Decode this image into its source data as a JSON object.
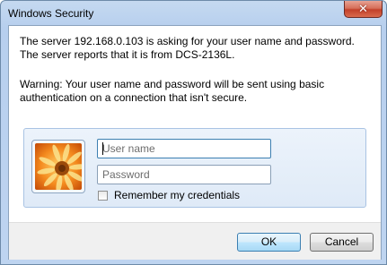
{
  "window": {
    "title": "Windows Security"
  },
  "titlebar": {
    "close_icon": "close-icon",
    "close_glyph": "✕"
  },
  "message": {
    "line1": "The server 192.168.0.103 is asking for your user name and password. The server reports that it is from DCS-2136L.",
    "line2": "Warning: Your user name and password will be sent using basic authentication on a connection that isn't secure."
  },
  "credentials": {
    "user_tile_icon": "flower-user-tile-icon",
    "username": {
      "value": "",
      "placeholder": "User name"
    },
    "password": {
      "value": "",
      "placeholder": "Password"
    },
    "remember": {
      "label": "Remember my credentials",
      "checked": false
    }
  },
  "buttons": {
    "ok_label": "OK",
    "cancel_label": "Cancel"
  },
  "colors": {
    "titlebar": "#bed4f0",
    "close_button": "#c3402a",
    "panel": "#dfeaf7",
    "focus_border": "#3c7fb1"
  }
}
